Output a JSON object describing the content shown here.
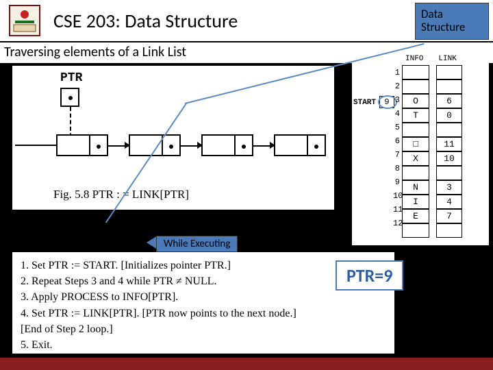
{
  "header": {
    "title": "CSE 203: Data Structure",
    "badge_line1": "Data",
    "badge_line2": "Structure"
  },
  "subtitle": "Traversing elements of a Link List",
  "fig_left": {
    "ptr_label": "PTR",
    "caption": "Fig. 5.8    PTR : = LINK[PTR]"
  },
  "fig_right": {
    "col1": "INFO",
    "col2": "LINK",
    "start_label": "START",
    "start_value": "9",
    "rows": [
      {
        "n": "1",
        "info": "",
        "link": ""
      },
      {
        "n": "2",
        "info": "",
        "link": ""
      },
      {
        "n": "3",
        "info": "O",
        "link": "6"
      },
      {
        "n": "4",
        "info": "T",
        "link": "0"
      },
      {
        "n": "5",
        "info": "",
        "link": ""
      },
      {
        "n": "6",
        "info": "□",
        "link": "11"
      },
      {
        "n": "7",
        "info": "X",
        "link": "10"
      },
      {
        "n": "8",
        "info": "",
        "link": ""
      },
      {
        "n": "9",
        "info": "N",
        "link": "3"
      },
      {
        "n": "10",
        "info": "I",
        "link": "4"
      },
      {
        "n": "11",
        "info": "E",
        "link": "7"
      },
      {
        "n": "12",
        "info": "",
        "link": ""
      }
    ]
  },
  "algo": {
    "s1": "1.  Set PTR := START.  [Initializes pointer PTR.]",
    "s2": "2.  Repeat Steps 3 and 4 while PTR ≠ NULL.",
    "s3": "3.      Apply PROCESS to INFO[PTR].",
    "s4": "4.      Set PTR := LINK[PTR].  [PTR now points to the next node.]",
    "s5": "    [End of Step 2 loop.]",
    "s6": "5.  Exit."
  },
  "while_label": "While Executing",
  "ptr_badge": "PTR=9"
}
